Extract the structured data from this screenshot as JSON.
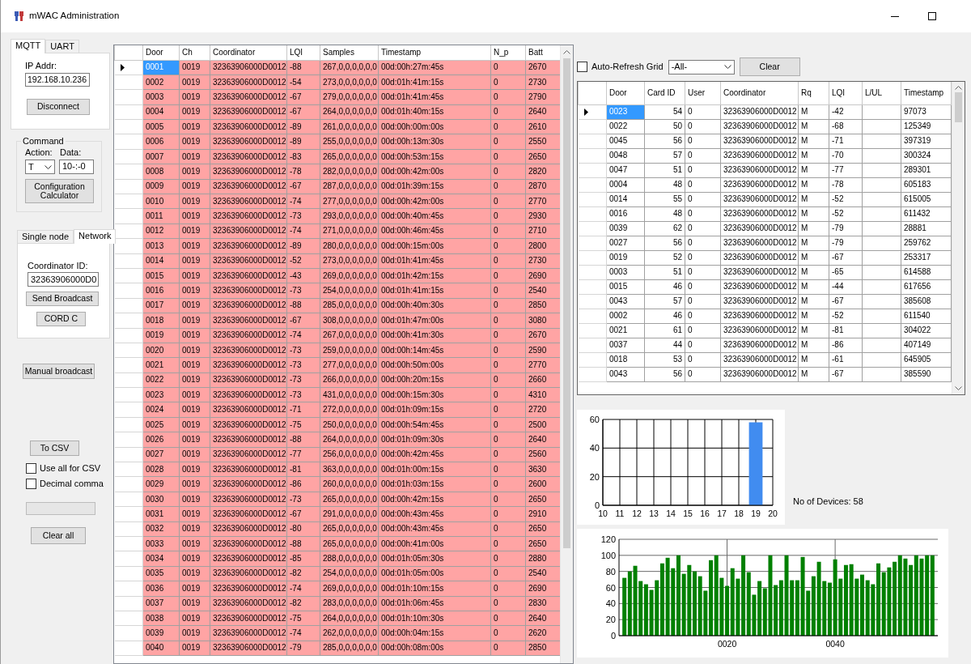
{
  "window": {
    "title": "mWAC Administration"
  },
  "connection_tabs": [
    {
      "label": "MQTT",
      "selected": true
    },
    {
      "label": "UART",
      "selected": false
    }
  ],
  "mqtt": {
    "ip_label": "IP Addr:",
    "ip_value": "192.168.10.236",
    "disconnect_button": "Disconnect"
  },
  "command": {
    "title": "Command",
    "action_label": "Action:",
    "action_value": "T",
    "data_label": "Data:",
    "data_value": "10-:-0",
    "calculator_button": "Configuration Calculator"
  },
  "mode_tabs": [
    {
      "label": "Single node",
      "selected": false
    },
    {
      "label": "Network",
      "selected": true
    }
  ],
  "network": {
    "coordinator_label": "Coordinator ID:",
    "coordinator_value": "32363906000D0",
    "broadcast_button": "Send Broadcast",
    "cord_button": "CORD C"
  },
  "manual_broadcast_button": "Manual broadcast",
  "csv": {
    "button": "To CSV",
    "options": [
      {
        "label": "Use all for CSV",
        "checked": false
      },
      {
        "label": "Decimal comma",
        "checked": false
      }
    ]
  },
  "progress": {
    "level": 0
  },
  "clear_all_button": "Clear all",
  "main_grid": {
    "columns": [
      "Door",
      "Ch",
      "Coordinator",
      "LQI",
      "Samples",
      "Timestamp",
      "N_p",
      "Batt"
    ],
    "rows": [
      {
        "selected": true,
        "cells": [
          "0001",
          "0019",
          "32363906000D0012",
          "-88",
          "267,0,0,0,0,0,0",
          "00d:00h:27m:45s",
          "0",
          "2670"
        ]
      },
      {
        "selected": false,
        "cells": [
          "0002",
          "0019",
          "32363906000D0012",
          "-54",
          "273,0,0,0,0,0,0",
          "00d:01h:41m:15s",
          "0",
          "2730"
        ]
      },
      {
        "selected": false,
        "cells": [
          "0003",
          "0019",
          "32363906000D0012",
          "-67",
          "279,0,0,0,0,0,0",
          "00d:01h:41m:45s",
          "0",
          "2790"
        ]
      },
      {
        "selected": false,
        "cells": [
          "0004",
          "0019",
          "32363906000D0012",
          "-67",
          "264,0,0,0,0,0,0",
          "00d:01h:40m:15s",
          "0",
          "2640"
        ]
      },
      {
        "selected": false,
        "cells": [
          "0005",
          "0019",
          "32363906000D0012",
          "-89",
          "261,0,0,0,0,0,0",
          "00d:00h:00m:00s",
          "0",
          "2610"
        ]
      },
      {
        "selected": false,
        "cells": [
          "0006",
          "0019",
          "32363906000D0012",
          "-89",
          "255,0,0,0,0,0,0",
          "00d:00h:13m:30s",
          "0",
          "2550"
        ]
      },
      {
        "selected": false,
        "cells": [
          "0007",
          "0019",
          "32363906000D0012",
          "-83",
          "265,0,0,0,0,0,0",
          "00d:00h:53m:15s",
          "0",
          "2650"
        ]
      },
      {
        "selected": false,
        "cells": [
          "0008",
          "0019",
          "32363906000D0012",
          "-78",
          "282,0,0,0,0,0,0",
          "00d:00h:42m:00s",
          "0",
          "2820"
        ]
      },
      {
        "selected": false,
        "cells": [
          "0009",
          "0019",
          "32363906000D0012",
          "-67",
          "287,0,0,0,0,0,0",
          "00d:01h:39m:15s",
          "0",
          "2870"
        ]
      },
      {
        "selected": false,
        "cells": [
          "0010",
          "0019",
          "32363906000D0012",
          "-74",
          "277,0,0,0,0,0,0",
          "00d:00h:42m:00s",
          "0",
          "2770"
        ]
      },
      {
        "selected": false,
        "cells": [
          "0011",
          "0019",
          "32363906000D0012",
          "-73",
          "293,0,0,0,0,0,0",
          "00d:00h:40m:45s",
          "0",
          "2930"
        ]
      },
      {
        "selected": false,
        "cells": [
          "0012",
          "0019",
          "32363906000D0012",
          "-74",
          "271,0,0,0,0,0,0",
          "00d:00h:46m:45s",
          "0",
          "2710"
        ]
      },
      {
        "selected": false,
        "cells": [
          "0013",
          "0019",
          "32363906000D0012",
          "-89",
          "280,0,0,0,0,0,0",
          "00d:00h:15m:00s",
          "0",
          "2800"
        ]
      },
      {
        "selected": false,
        "cells": [
          "0014",
          "0019",
          "32363906000D0012",
          "-52",
          "273,0,0,0,0,0,0",
          "00d:01h:41m:45s",
          "0",
          "2730"
        ]
      },
      {
        "selected": false,
        "cells": [
          "0015",
          "0019",
          "32363906000D0012",
          "-43",
          "269,0,0,0,0,0,0",
          "00d:01h:42m:15s",
          "0",
          "2690"
        ]
      },
      {
        "selected": false,
        "cells": [
          "0016",
          "0019",
          "32363906000D0012",
          "-73",
          "254,0,0,0,0,0,0",
          "00d:01h:41m:15s",
          "0",
          "2540"
        ]
      },
      {
        "selected": false,
        "cells": [
          "0017",
          "0019",
          "32363906000D0012",
          "-88",
          "285,0,0,0,0,0,0",
          "00d:00h:40m:30s",
          "0",
          "2850"
        ]
      },
      {
        "selected": false,
        "cells": [
          "0018",
          "0019",
          "32363906000D0012",
          "-67",
          "308,0,0,0,0,0,0",
          "00d:01h:47m:00s",
          "0",
          "3080"
        ]
      },
      {
        "selected": false,
        "cells": [
          "0019",
          "0019",
          "32363906000D0012",
          "-74",
          "267,0,0,0,0,0,0",
          "00d:00h:41m:30s",
          "0",
          "2670"
        ]
      },
      {
        "selected": false,
        "cells": [
          "0020",
          "0019",
          "32363906000D0012",
          "-73",
          "259,0,0,0,0,0,0",
          "00d:00h:14m:45s",
          "0",
          "2590"
        ]
      },
      {
        "selected": false,
        "cells": [
          "0021",
          "0019",
          "32363906000D0012",
          "-73",
          "277,0,0,0,0,0,0",
          "00d:00h:50m:00s",
          "0",
          "2770"
        ]
      },
      {
        "selected": false,
        "cells": [
          "0022",
          "0019",
          "32363906000D0012",
          "-73",
          "266,0,0,0,0,0,0",
          "00d:00h:20m:15s",
          "0",
          "2660"
        ]
      },
      {
        "selected": false,
        "cells": [
          "0023",
          "0019",
          "32363906000D0012",
          "-73",
          "431,0,0,0,0,0,0",
          "00d:00h:15m:30s",
          "0",
          "4310"
        ]
      },
      {
        "selected": false,
        "cells": [
          "0024",
          "0019",
          "32363906000D0012",
          "-71",
          "272,0,0,0,0,0,0",
          "00d:01h:09m:15s",
          "0",
          "2720"
        ]
      },
      {
        "selected": false,
        "cells": [
          "0025",
          "0019",
          "32363906000D0012",
          "-75",
          "250,0,0,0,0,0,0",
          "00d:00h:54m:45s",
          "0",
          "2500"
        ]
      },
      {
        "selected": false,
        "cells": [
          "0026",
          "0019",
          "32363906000D0012",
          "-88",
          "264,0,0,0,0,0,0",
          "00d:01h:09m:30s",
          "0",
          "2640"
        ]
      },
      {
        "selected": false,
        "cells": [
          "0027",
          "0019",
          "32363906000D0012",
          "-77",
          "256,0,0,0,0,0,0",
          "00d:00h:42m:45s",
          "0",
          "2560"
        ]
      },
      {
        "selected": false,
        "cells": [
          "0028",
          "0019",
          "32363906000D0012",
          "-81",
          "363,0,0,0,0,0,0",
          "00d:01h:00m:15s",
          "0",
          "3630"
        ]
      },
      {
        "selected": false,
        "cells": [
          "0029",
          "0019",
          "32363906000D0012",
          "-86",
          "260,0,0,0,0,0,0",
          "00d:01h:03m:15s",
          "0",
          "2600"
        ]
      },
      {
        "selected": false,
        "cells": [
          "0030",
          "0019",
          "32363906000D0012",
          "-73",
          "265,0,0,0,0,0,0",
          "00d:00h:42m:15s",
          "0",
          "2650"
        ]
      },
      {
        "selected": false,
        "cells": [
          "0031",
          "0019",
          "32363906000D0012",
          "-67",
          "291,0,0,0,0,0,0",
          "00d:00h:43m:45s",
          "0",
          "2910"
        ]
      },
      {
        "selected": false,
        "cells": [
          "0032",
          "0019",
          "32363906000D0012",
          "-80",
          "265,0,0,0,0,0,0",
          "00d:00h:43m:45s",
          "0",
          "2650"
        ]
      },
      {
        "selected": false,
        "cells": [
          "0033",
          "0019",
          "32363906000D0012",
          "-88",
          "265,0,0,0,0,0,0",
          "00d:00h:41m:00s",
          "0",
          "2650"
        ]
      },
      {
        "selected": false,
        "cells": [
          "0034",
          "0019",
          "32363906000D0012",
          "-85",
          "288,0,0,0,0,0,0",
          "00d:01h:05m:30s",
          "0",
          "2880"
        ]
      },
      {
        "selected": false,
        "cells": [
          "0035",
          "0019",
          "32363906000D0012",
          "-82",
          "254,0,0,0,0,0,0",
          "00d:01h:05m:00s",
          "0",
          "2540"
        ]
      },
      {
        "selected": false,
        "cells": [
          "0036",
          "0019",
          "32363906000D0012",
          "-74",
          "269,0,0,0,0,0,0",
          "00d:01h:10m:15s",
          "0",
          "2690"
        ]
      },
      {
        "selected": false,
        "cells": [
          "0037",
          "0019",
          "32363906000D0012",
          "-82",
          "283,0,0,0,0,0,0",
          "00d:01h:06m:45s",
          "0",
          "2830"
        ]
      },
      {
        "selected": false,
        "cells": [
          "0038",
          "0019",
          "32363906000D0012",
          "-75",
          "264,0,0,0,0,0,0",
          "00d:01h:10m:30s",
          "0",
          "2640"
        ]
      },
      {
        "selected": false,
        "cells": [
          "0039",
          "0019",
          "32363906000D0012",
          "-74",
          "262,0,0,0,0,0,0",
          "00d:00h:04m:15s",
          "0",
          "2620"
        ]
      },
      {
        "selected": false,
        "cells": [
          "0040",
          "0019",
          "32363906000D0012",
          "-79",
          "285,0,0,0,0,0,0",
          "00d:00h:08m:00s",
          "0",
          "2850"
        ]
      }
    ]
  },
  "filter": {
    "auto_refresh": {
      "label": "Auto-Refresh Grid",
      "checked": false
    },
    "selection": "-All-",
    "clear_button": "Clear"
  },
  "card_grid": {
    "columns": [
      "Door",
      "Card ID",
      "User",
      "Coordinator",
      "Rq",
      "LQI",
      "L/UL",
      "Timestamp"
    ],
    "rows": [
      {
        "selected": true,
        "cells": [
          "0023",
          "54",
          "0",
          "32363906000D0012",
          "M",
          "-42",
          null,
          "97073"
        ]
      },
      {
        "selected": false,
        "cells": [
          "0022",
          "50",
          "0",
          "32363906000D0012",
          "M",
          "-68",
          null,
          "125349"
        ]
      },
      {
        "selected": false,
        "cells": [
          "0045",
          "56",
          "0",
          "32363906000D0012",
          "M",
          "-71",
          null,
          "397319"
        ]
      },
      {
        "selected": false,
        "cells": [
          "0048",
          "57",
          "0",
          "32363906000D0012",
          "M",
          "-70",
          null,
          "300324"
        ]
      },
      {
        "selected": false,
        "cells": [
          "0047",
          "51",
          "0",
          "32363906000D0012",
          "M",
          "-77",
          null,
          "289301"
        ]
      },
      {
        "selected": false,
        "cells": [
          "0004",
          "48",
          "0",
          "32363906000D0012",
          "M",
          "-78",
          null,
          "605183"
        ]
      },
      {
        "selected": false,
        "cells": [
          "0014",
          "55",
          "0",
          "32363906000D0012",
          "M",
          "-52",
          null,
          "615005"
        ]
      },
      {
        "selected": false,
        "cells": [
          "0016",
          "48",
          "0",
          "32363906000D0012",
          "M",
          "-52",
          null,
          "611432"
        ]
      },
      {
        "selected": false,
        "cells": [
          "0039",
          "62",
          "0",
          "32363906000D0012",
          "M",
          "-79",
          null,
          "28881"
        ]
      },
      {
        "selected": false,
        "cells": [
          "0027",
          "56",
          "0",
          "32363906000D0012",
          "M",
          "-79",
          null,
          "259762"
        ]
      },
      {
        "selected": false,
        "cells": [
          "0019",
          "52",
          "0",
          "32363906000D0012",
          "M",
          "-67",
          null,
          "253317"
        ]
      },
      {
        "selected": false,
        "cells": [
          "0003",
          "51",
          "0",
          "32363906000D0012",
          "M",
          "-65",
          null,
          "614588"
        ]
      },
      {
        "selected": false,
        "cells": [
          "0015",
          "46",
          "0",
          "32363906000D0012",
          "M",
          "-44",
          null,
          "617656"
        ]
      },
      {
        "selected": false,
        "cells": [
          "0043",
          "57",
          "0",
          "32363906000D0012",
          "M",
          "-67",
          null,
          "385608"
        ]
      },
      {
        "selected": false,
        "cells": [
          "0002",
          "46",
          "0",
          "32363906000D0012",
          "M",
          "-52",
          null,
          "611540"
        ]
      },
      {
        "selected": false,
        "cells": [
          "0021",
          "61",
          "0",
          "32363906000D0012",
          "M",
          "-81",
          null,
          "304022"
        ]
      },
      {
        "selected": false,
        "cells": [
          "0037",
          "44",
          "0",
          "32363906000D0012",
          "M",
          "-86",
          null,
          "407149"
        ]
      },
      {
        "selected": false,
        "cells": [
          "0018",
          "53",
          "0",
          "32363906000D0012",
          "M",
          "-61",
          null,
          "645905"
        ]
      },
      {
        "selected": false,
        "cells": [
          "0043",
          "56",
          "0",
          "32363906000D0012",
          "M",
          "-67",
          null,
          "385590"
        ]
      }
    ]
  },
  "channel_chart": {
    "chart_data": {
      "type": "bar",
      "grid": true,
      "x": [
        19
      ],
      "series": [
        {
          "color": "#418cf0",
          "values": [
            58
          ]
        }
      ],
      "xlim": [
        10,
        20
      ],
      "ylim": [
        0,
        60
      ],
      "xticks": [
        10,
        11,
        12,
        13,
        14,
        15,
        16,
        17,
        18,
        19,
        20
      ],
      "yticks": [
        0,
        20,
        40,
        60
      ]
    }
  },
  "device_count": "No of Devices: 58",
  "lqi_chart": {
    "chart_data": {
      "type": "bar",
      "grid": true,
      "x": [
        1,
        2,
        3,
        4,
        5,
        6,
        7,
        8,
        9,
        10,
        11,
        12,
        13,
        14,
        15,
        16,
        17,
        18,
        19,
        20,
        21,
        22,
        23,
        24,
        25,
        26,
        27,
        28,
        29,
        30,
        31,
        32,
        33,
        34,
        35,
        36,
        37,
        38,
        39,
        40,
        41,
        42,
        43,
        44,
        45,
        46,
        47,
        48,
        49,
        50,
        51,
        52,
        53,
        54,
        55,
        56,
        57,
        58
      ],
      "xlim": [
        0,
        59
      ],
      "series": [
        {
          "color": "#008000",
          "values": [
            72,
            80,
            87,
            68,
            64,
            57,
            69,
            90,
            97,
            84,
            100,
            77,
            88,
            80,
            74,
            56,
            94,
            100,
            72,
            62,
            84,
            71,
            100,
            79,
            51,
            68,
            59,
            100,
            63,
            69,
            100,
            69,
            69,
            98,
            56,
            74,
            92,
            68,
            66,
            95,
            71,
            88,
            89,
            71,
            76,
            69,
            64,
            90,
            79,
            85,
            92,
            100,
            96,
            88,
            100,
            96,
            100,
            100
          ]
        }
      ],
      "ylim": [
        0,
        120
      ],
      "xticks": [
        {
          "value": 20,
          "label": "0020"
        },
        {
          "value": 40,
          "label": "0040"
        }
      ],
      "yticks": [
        0,
        20,
        40,
        60,
        80,
        100,
        120
      ]
    }
  }
}
